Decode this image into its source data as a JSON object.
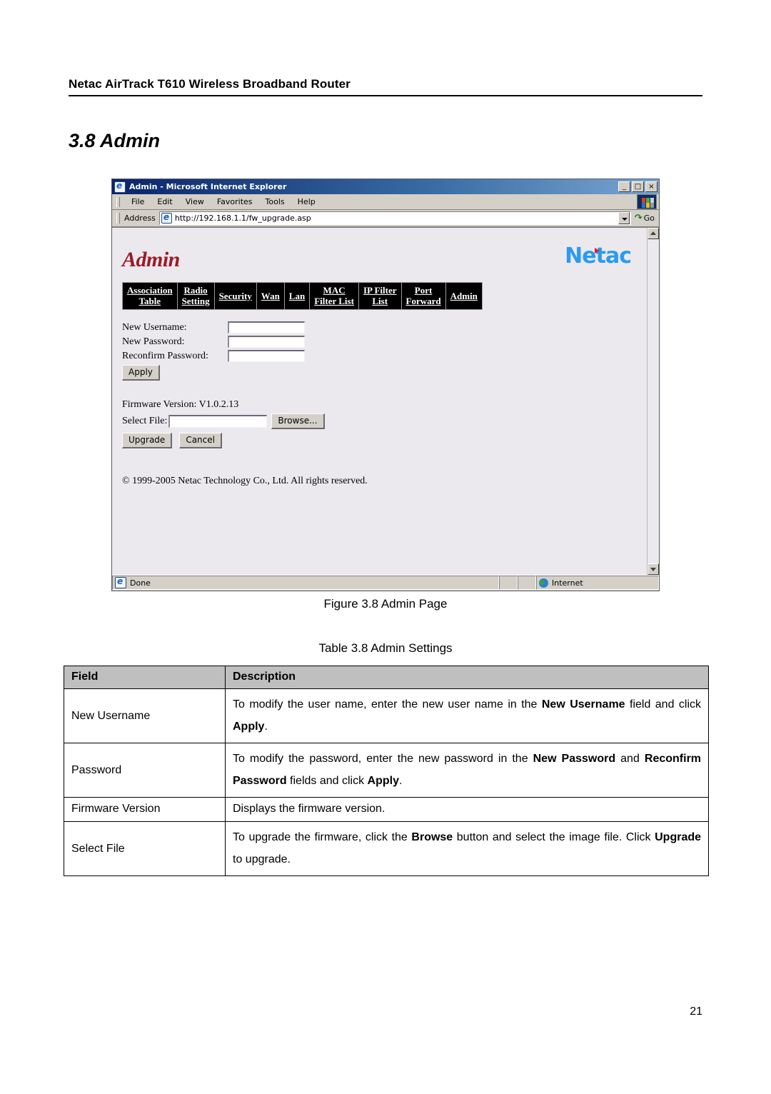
{
  "document": {
    "running_header": "Netac AirTrack T610 Wireless Broadband Router",
    "section_title": "3.8 Admin",
    "figure_caption": "Figure 3.8 Admin Page",
    "table_caption": "Table 3.8 Admin Settings",
    "page_number": "21"
  },
  "browser": {
    "window_title": "Admin - Microsoft Internet Explorer",
    "icon": "ie-icon",
    "window_buttons": {
      "minimize": "_",
      "restore": "□",
      "close": "×"
    },
    "menu_items": [
      "File",
      "Edit",
      "View",
      "Favorites",
      "Tools",
      "Help"
    ],
    "address": {
      "label": "Address",
      "url": "http://192.168.1.1/fw_upgrade.asp",
      "go_label": "Go",
      "go_icon": "go-arrow-icon",
      "dropdown_icon": "chevron-down-icon"
    },
    "status": {
      "message": "Done",
      "zone": "Internet",
      "zone_icon": "globe-icon"
    },
    "scrollbar": {
      "up_icon": "scroll-up-arrow-icon",
      "down_icon": "scroll-down-arrow-icon"
    }
  },
  "webpage": {
    "page_heading": "Admin",
    "logo_text": "Netac",
    "logo_colors": {
      "text": "#2a9bf0",
      "accent": "#e02020"
    },
    "heading_color": "#9b1b26",
    "nav_tabs": [
      {
        "line1": "Association",
        "line2": "Table"
      },
      {
        "line1": "Radio",
        "line2": "Setting"
      },
      {
        "line1": "Security",
        "line2": ""
      },
      {
        "line1": "Wan",
        "line2": ""
      },
      {
        "line1": "Lan",
        "line2": ""
      },
      {
        "line1": "MAC",
        "line2": "Filter List"
      },
      {
        "line1": "IP Filter",
        "line2": "List"
      },
      {
        "line1": "Port",
        "line2": "Forward"
      },
      {
        "line1": "Admin",
        "line2": ""
      }
    ],
    "form": {
      "fields": [
        {
          "label": "New Username:",
          "value": ""
        },
        {
          "label": "New Password:",
          "value": ""
        },
        {
          "label": "Reconfirm Password:",
          "value": ""
        }
      ],
      "apply_label": "Apply"
    },
    "firmware": {
      "version_line": "Firmware Version: V1.0.2.13",
      "select_file_label": "Select File:",
      "select_file_value": "",
      "browse_label": "Browse...",
      "upgrade_label": "Upgrade",
      "cancel_label": "Cancel"
    },
    "copyright": "© 1999-2005 Netac Technology Co., Ltd. All rights reserved."
  },
  "settings_table": {
    "headers": {
      "field": "Field",
      "description": "Description"
    },
    "rows": [
      {
        "field": "New Username",
        "desc_html": "To modify the user name, enter the new user name in the <b>New Username</b> field and click <b>Apply</b>."
      },
      {
        "field": "Password",
        "desc_html": "To modify the password, enter the new password in the <b>New Password</b> and <b>Reconfirm Password</b> fields and click <b>Apply</b>."
      },
      {
        "field": "Firmware Version",
        "desc_html": "Displays the firmware version."
      },
      {
        "field": "Select File",
        "desc_html": "To upgrade the firmware, click the <b>Browse</b> button and select the image file. Click <b>Upgrade</b> to upgrade."
      }
    ]
  }
}
